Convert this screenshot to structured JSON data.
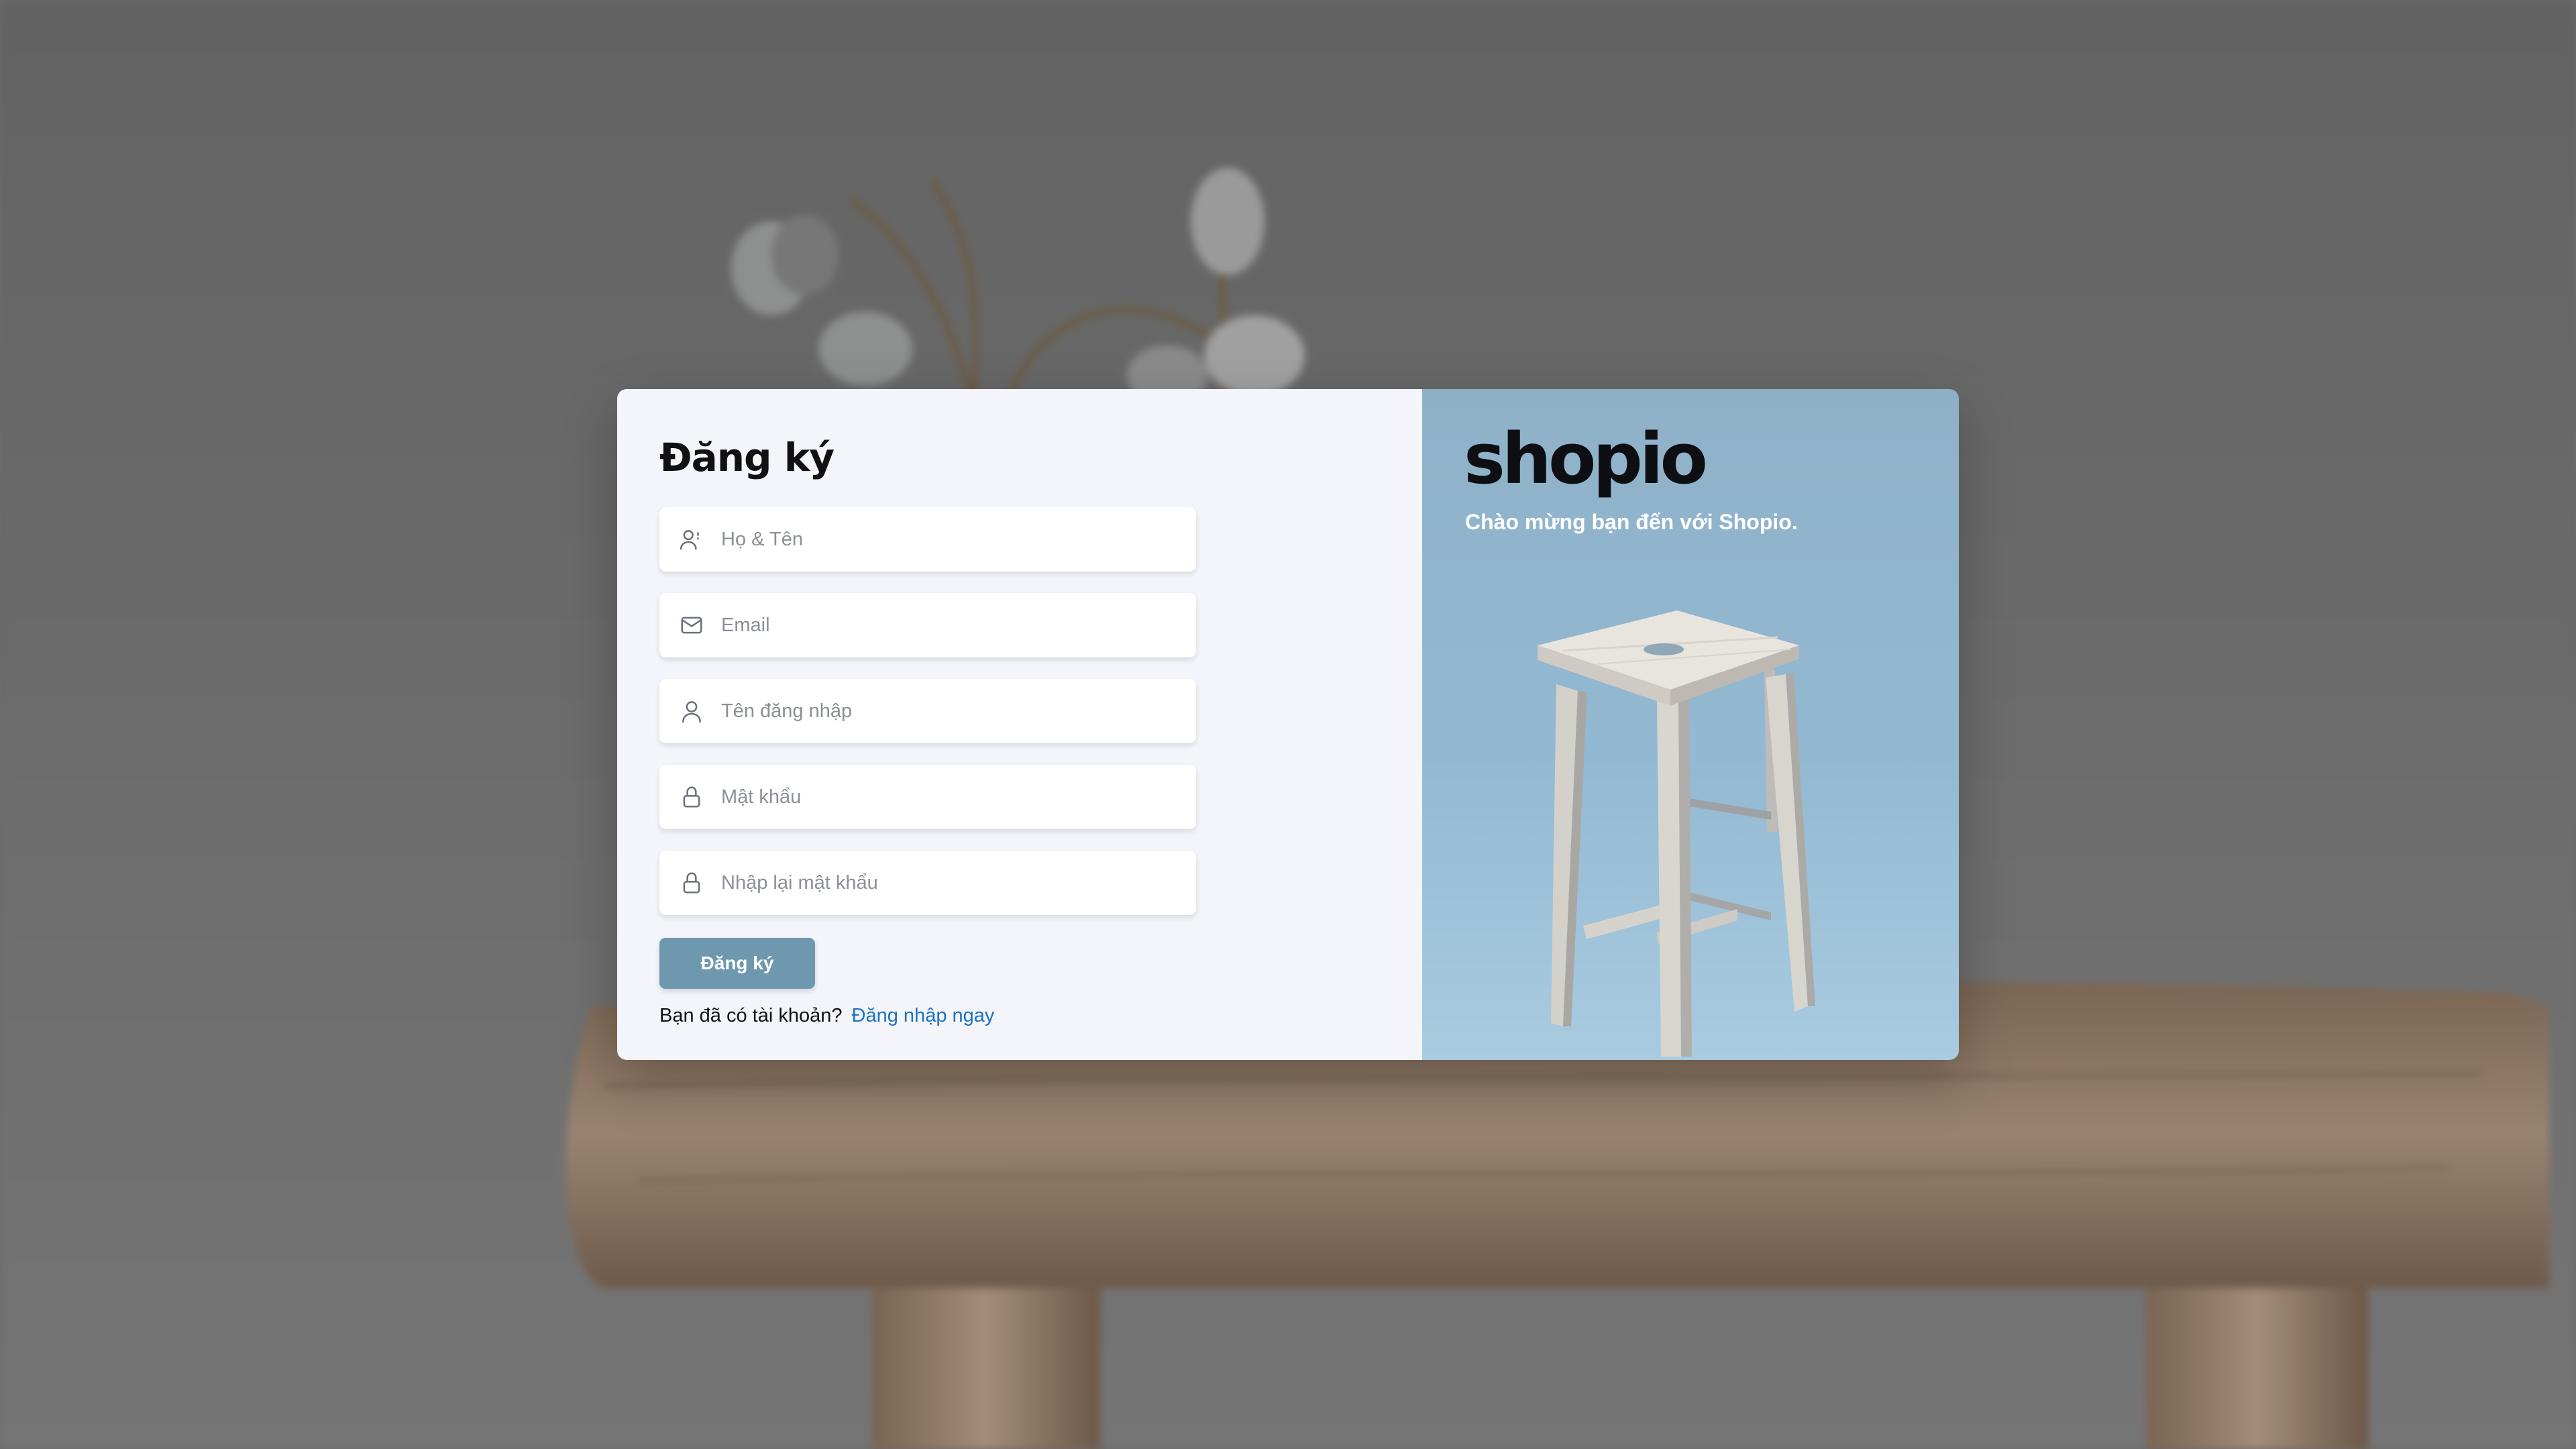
{
  "signup": {
    "title": "Đăng ký",
    "fields": [
      {
        "icon": "user-plus-icon",
        "placeholder": "Họ & Tên",
        "value": ""
      },
      {
        "icon": "mail-icon",
        "placeholder": "Email",
        "value": ""
      },
      {
        "icon": "user-icon",
        "placeholder": "Tên đăng nhập",
        "value": ""
      },
      {
        "icon": "lock-icon",
        "placeholder": "Mật khẩu",
        "value": ""
      },
      {
        "icon": "lock-icon",
        "placeholder": "Nhập lại mật khẩu",
        "value": ""
      }
    ],
    "submit_label": "Đăng ký",
    "have_account_text": "Bạn đã có tài khoản?",
    "login_link": "Đăng nhập ngay"
  },
  "brand": {
    "logo": "shopio",
    "welcome": "Chào mừng bạn đến với Shopio."
  },
  "colors": {
    "button": "#6e98ae",
    "link": "#1a73c2",
    "panel_left": "#f4f5fa",
    "panel_right": "#93b9d2"
  }
}
